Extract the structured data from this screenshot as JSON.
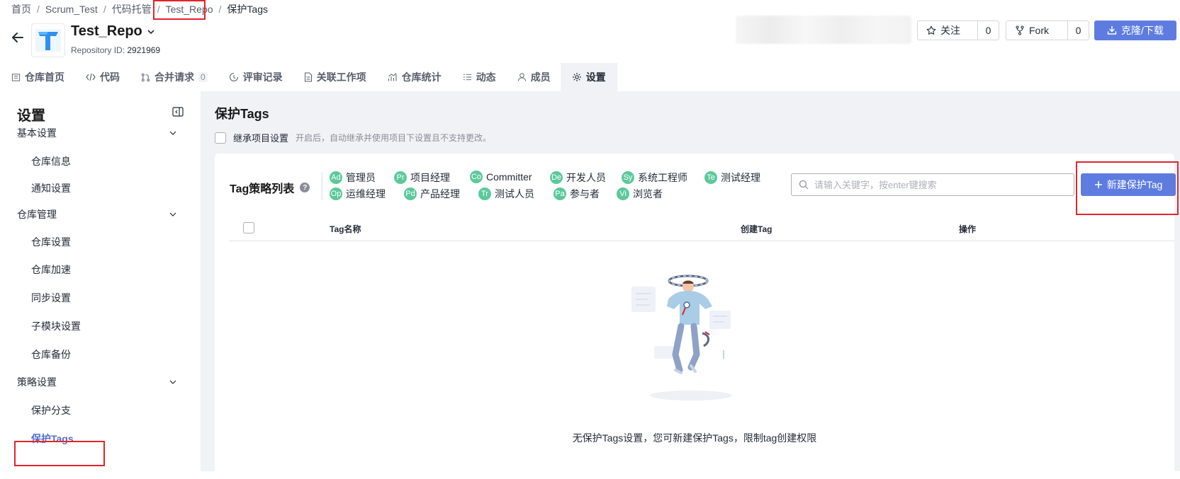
{
  "breadcrumb": [
    "首页",
    "Scrum_Test",
    "代码托管",
    "Test_Repo",
    "保护Tags"
  ],
  "repo": {
    "name": "Test_Repo",
    "id_label": "Repository ID:",
    "id_value": "2921969"
  },
  "actions": {
    "watch_label": "关注",
    "watch_count": "0",
    "fork_label": "Fork",
    "fork_count": "0",
    "clone_label": "克隆/下载"
  },
  "tabs": [
    {
      "label": "仓库首页",
      "icon": "repo-home-icon"
    },
    {
      "label": "代码",
      "icon": "code-icon"
    },
    {
      "label": "合并请求",
      "icon": "merge-request-icon",
      "badge": "0"
    },
    {
      "label": "评审记录",
      "icon": "review-icon"
    },
    {
      "label": "关联工作项",
      "icon": "document-icon"
    },
    {
      "label": "仓库统计",
      "icon": "chart-icon"
    },
    {
      "label": "动态",
      "icon": "list-icon"
    },
    {
      "label": "成员",
      "icon": "user-icon"
    },
    {
      "label": "设置",
      "icon": "gear-icon",
      "active": true
    }
  ],
  "sidebar": {
    "title": "设置",
    "groups": [
      {
        "label": "基本设置",
        "items": [
          "仓库信息",
          "通知设置"
        ]
      },
      {
        "label": "仓库管理",
        "items": [
          "仓库设置",
          "仓库加速",
          "同步设置",
          "子模块设置",
          "仓库备份"
        ]
      },
      {
        "label": "策略设置",
        "items": [
          "保护分支",
          "保护Tags"
        ]
      }
    ],
    "active_item": "保护Tags"
  },
  "main": {
    "title": "保护Tags",
    "inherit_label": "继承项目设置",
    "inherit_desc": "开启后，自动继承并使用项目下设置且不支持更改。",
    "list_title": "Tag策略列表",
    "roles": [
      {
        "abbr": "Ad",
        "label": "管理员"
      },
      {
        "abbr": "Pr",
        "label": "项目经理"
      },
      {
        "abbr": "Co",
        "label": "Committer"
      },
      {
        "abbr": "De",
        "label": "开发人员"
      },
      {
        "abbr": "Sy",
        "label": "系统工程师"
      },
      {
        "abbr": "Te",
        "label": "测试经理"
      },
      {
        "abbr": "Op",
        "label": "运维经理"
      },
      {
        "abbr": "Pd",
        "label": "产品经理"
      },
      {
        "abbr": "Tr",
        "label": "测试人员"
      },
      {
        "abbr": "Pa",
        "label": "参与者"
      },
      {
        "abbr": "Vi",
        "label": "浏览者"
      }
    ],
    "search_placeholder": "请输入关键字，按enter键搜索",
    "new_button": "新建保护Tag",
    "columns": [
      "Tag名称",
      "创建Tag",
      "操作"
    ],
    "empty_text": "无保护Tags设置，您可新建保护Tags，限制tag创建权限"
  },
  "colors": {
    "primary": "#5e7ce0",
    "active_menu": "#526ecc",
    "role_avatar": "#5cc99b",
    "highlight": "#e3242b",
    "content_bg": "#f0f2f5"
  }
}
